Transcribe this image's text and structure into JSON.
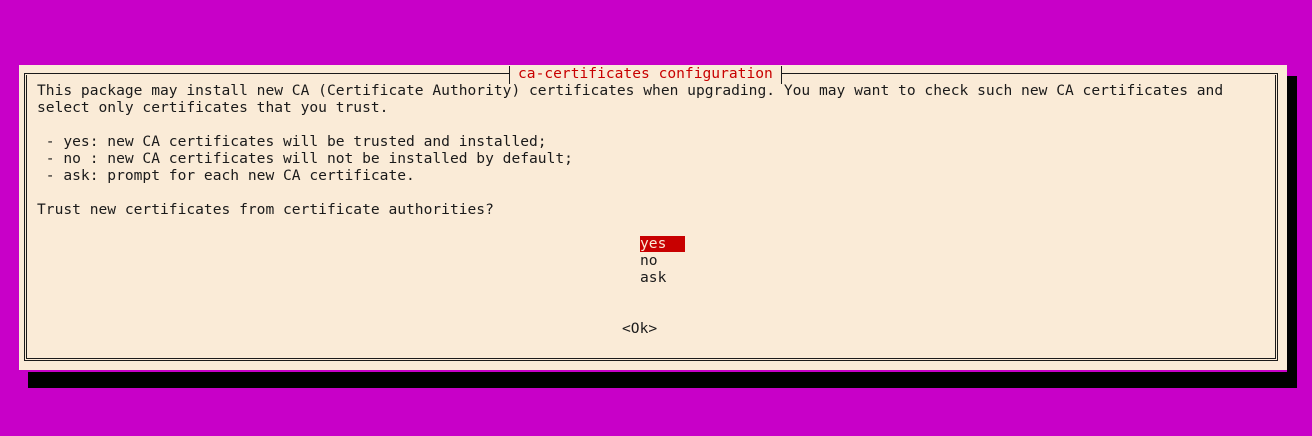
{
  "dialog": {
    "title": "ca-certificates configuration",
    "description": [
      "This package may install new CA (Certificate Authority) certificates when upgrading. You may want to check such new CA certificates and",
      "select only certificates that you trust."
    ],
    "options_help": [
      " - yes: new CA certificates will be trusted and installed;",
      " - no : new CA certificates will not be installed by default;",
      " - ask: prompt for each new CA certificate."
    ],
    "question": "Trust new certificates from certificate authorities?",
    "choices": [
      "yes",
      "no",
      "ask"
    ],
    "selected_choice": "yes",
    "ok_label": "<Ok>"
  },
  "colors": {
    "background": "#c800c8",
    "dialog_bg": "#faebd7",
    "accent": "#c80000",
    "text": "#1a1a1a"
  }
}
